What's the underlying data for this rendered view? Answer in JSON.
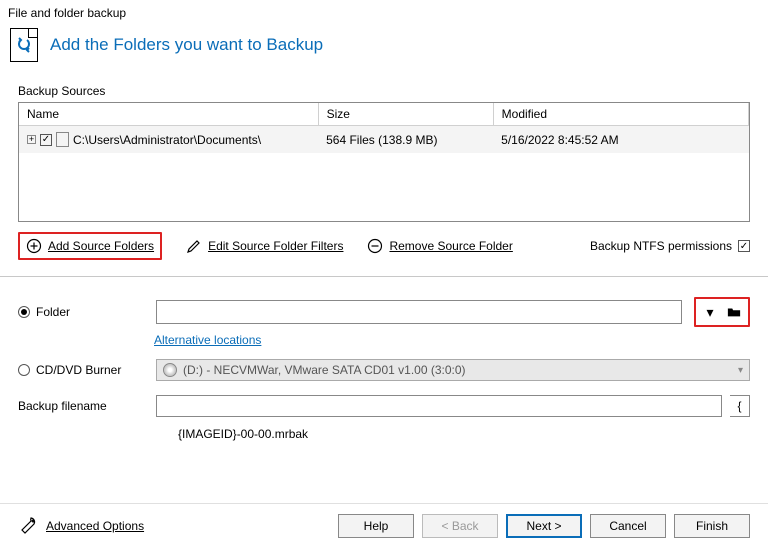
{
  "window": {
    "title": "File and folder backup"
  },
  "header": {
    "title": "Add the Folders you want to Backup"
  },
  "sources": {
    "label": "Backup Sources",
    "columns": {
      "name": "Name",
      "size": "Size",
      "modified": "Modified"
    },
    "rows": [
      {
        "name": "C:\\Users\\Administrator\\Documents\\",
        "size": "564 Files (138.9 MB)",
        "modified": "5/16/2022 8:45:52 AM"
      }
    ]
  },
  "actions": {
    "add": "Add Source Folders",
    "edit": "Edit Source Folder Filters",
    "remove": "Remove Source Folder",
    "ntfs": "Backup NTFS permissions"
  },
  "dest": {
    "folder_label": "Folder",
    "alt_link": "Alternative locations",
    "cd_label": "CD/DVD Burner",
    "cd_value": "(D:) - NECVMWar, VMware SATA CD01 v1.00 (3:0:0)",
    "filename_label": "Backup filename",
    "filename_value": "",
    "template": "{IMAGEID}-00-00.mrbak"
  },
  "footer": {
    "advanced": "Advanced Options",
    "help": "Help",
    "back": "< Back",
    "next": "Next >",
    "cancel": "Cancel",
    "finish": "Finish"
  }
}
